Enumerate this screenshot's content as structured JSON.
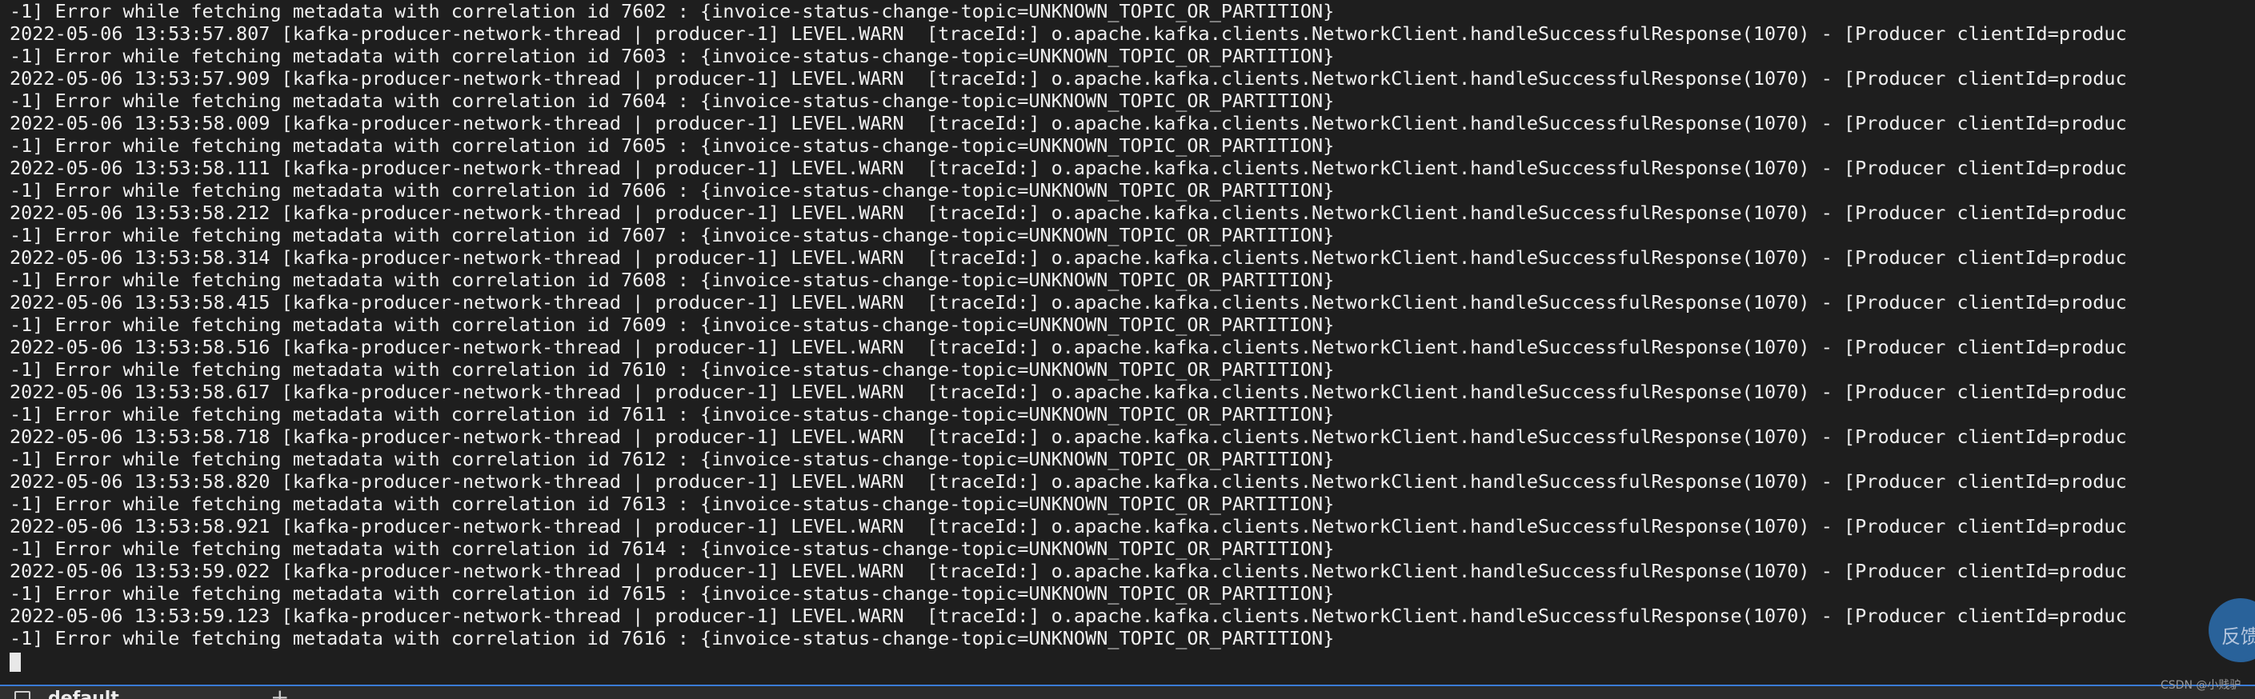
{
  "terminal": {
    "lines": [
      "-1] Error while fetching metadata with correlation id 7602 : {invoice-status-change-topic=UNKNOWN_TOPIC_OR_PARTITION}",
      "2022-05-06 13:53:57.807 [kafka-producer-network-thread | producer-1] LEVEL.WARN  [traceId:] o.apache.kafka.clients.NetworkClient.handleSuccessfulResponse(1070) - [Producer clientId=produc",
      "-1] Error while fetching metadata with correlation id 7603 : {invoice-status-change-topic=UNKNOWN_TOPIC_OR_PARTITION}",
      "2022-05-06 13:53:57.909 [kafka-producer-network-thread | producer-1] LEVEL.WARN  [traceId:] o.apache.kafka.clients.NetworkClient.handleSuccessfulResponse(1070) - [Producer clientId=produc",
      "-1] Error while fetching metadata with correlation id 7604 : {invoice-status-change-topic=UNKNOWN_TOPIC_OR_PARTITION}",
      "2022-05-06 13:53:58.009 [kafka-producer-network-thread | producer-1] LEVEL.WARN  [traceId:] o.apache.kafka.clients.NetworkClient.handleSuccessfulResponse(1070) - [Producer clientId=produc",
      "-1] Error while fetching metadata with correlation id 7605 : {invoice-status-change-topic=UNKNOWN_TOPIC_OR_PARTITION}",
      "2022-05-06 13:53:58.111 [kafka-producer-network-thread | producer-1] LEVEL.WARN  [traceId:] o.apache.kafka.clients.NetworkClient.handleSuccessfulResponse(1070) - [Producer clientId=produc",
      "-1] Error while fetching metadata with correlation id 7606 : {invoice-status-change-topic=UNKNOWN_TOPIC_OR_PARTITION}",
      "2022-05-06 13:53:58.212 [kafka-producer-network-thread | producer-1] LEVEL.WARN  [traceId:] o.apache.kafka.clients.NetworkClient.handleSuccessfulResponse(1070) - [Producer clientId=produc",
      "-1] Error while fetching metadata with correlation id 7607 : {invoice-status-change-topic=UNKNOWN_TOPIC_OR_PARTITION}",
      "2022-05-06 13:53:58.314 [kafka-producer-network-thread | producer-1] LEVEL.WARN  [traceId:] o.apache.kafka.clients.NetworkClient.handleSuccessfulResponse(1070) - [Producer clientId=produc",
      "-1] Error while fetching metadata with correlation id 7608 : {invoice-status-change-topic=UNKNOWN_TOPIC_OR_PARTITION}",
      "2022-05-06 13:53:58.415 [kafka-producer-network-thread | producer-1] LEVEL.WARN  [traceId:] o.apache.kafka.clients.NetworkClient.handleSuccessfulResponse(1070) - [Producer clientId=produc",
      "-1] Error while fetching metadata with correlation id 7609 : {invoice-status-change-topic=UNKNOWN_TOPIC_OR_PARTITION}",
      "2022-05-06 13:53:58.516 [kafka-producer-network-thread | producer-1] LEVEL.WARN  [traceId:] o.apache.kafka.clients.NetworkClient.handleSuccessfulResponse(1070) - [Producer clientId=produc",
      "-1] Error while fetching metadata with correlation id 7610 : {invoice-status-change-topic=UNKNOWN_TOPIC_OR_PARTITION}",
      "2022-05-06 13:53:58.617 [kafka-producer-network-thread | producer-1] LEVEL.WARN  [traceId:] o.apache.kafka.clients.NetworkClient.handleSuccessfulResponse(1070) - [Producer clientId=produc",
      "-1] Error while fetching metadata with correlation id 7611 : {invoice-status-change-topic=UNKNOWN_TOPIC_OR_PARTITION}",
      "2022-05-06 13:53:58.718 [kafka-producer-network-thread | producer-1] LEVEL.WARN  [traceId:] o.apache.kafka.clients.NetworkClient.handleSuccessfulResponse(1070) - [Producer clientId=produc",
      "-1] Error while fetching metadata with correlation id 7612 : {invoice-status-change-topic=UNKNOWN_TOPIC_OR_PARTITION}",
      "2022-05-06 13:53:58.820 [kafka-producer-network-thread | producer-1] LEVEL.WARN  [traceId:] o.apache.kafka.clients.NetworkClient.handleSuccessfulResponse(1070) - [Producer clientId=produc",
      "-1] Error while fetching metadata with correlation id 7613 : {invoice-status-change-topic=UNKNOWN_TOPIC_OR_PARTITION}",
      "2022-05-06 13:53:58.921 [kafka-producer-network-thread | producer-1] LEVEL.WARN  [traceId:] o.apache.kafka.clients.NetworkClient.handleSuccessfulResponse(1070) - [Producer clientId=produc",
      "-1] Error while fetching metadata with correlation id 7614 : {invoice-status-change-topic=UNKNOWN_TOPIC_OR_PARTITION}",
      "2022-05-06 13:53:59.022 [kafka-producer-network-thread | producer-1] LEVEL.WARN  [traceId:] o.apache.kafka.clients.NetworkClient.handleSuccessfulResponse(1070) - [Producer clientId=produc",
      "-1] Error while fetching metadata with correlation id 7615 : {invoice-status-change-topic=UNKNOWN_TOPIC_OR_PARTITION}",
      "2022-05-06 13:53:59.123 [kafka-producer-network-thread | producer-1] LEVEL.WARN  [traceId:] o.apache.kafka.clients.NetworkClient.handleSuccessfulResponse(1070) - [Producer clientId=produc",
      "-1] Error while fetching metadata with correlation id 7616 : {invoice-status-change-topic=UNKNOWN_TOPIC_OR_PARTITION}"
    ],
    "colors": {
      "background": "#1e1e1e",
      "foreground": "#f0f0f0",
      "accent": "#3a7bd5"
    }
  },
  "tab_bar": {
    "tab_label": "default",
    "tab_icon": "terminal-icon",
    "add_icon": "plus-icon",
    "add_label": "+"
  },
  "overlay": {
    "feedback_label": "反馈",
    "watermark": "CSDN @小贱驴"
  }
}
